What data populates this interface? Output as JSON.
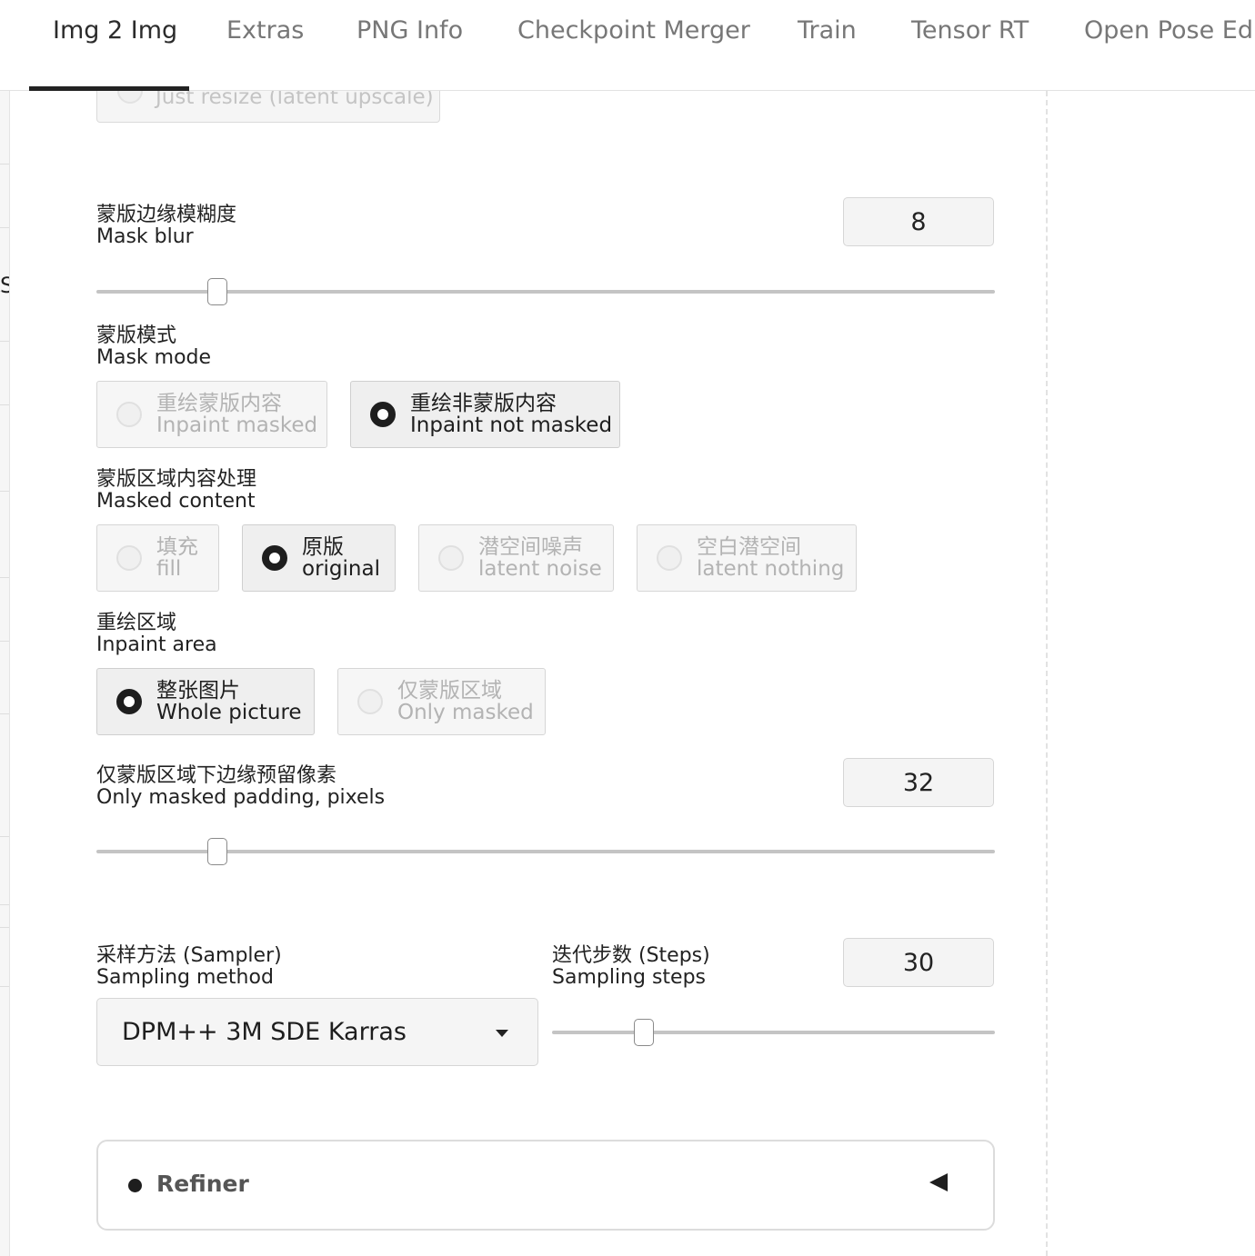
{
  "tabs": [
    {
      "label": "Img 2 Img",
      "active": true
    },
    {
      "label": "Extras"
    },
    {
      "label": "PNG Info"
    },
    {
      "label": "Checkpoint Merger"
    },
    {
      "label": "Train"
    },
    {
      "label": "Tensor RT"
    },
    {
      "label": "Open Pose Edit"
    }
  ],
  "left_strip": {
    "partial_char": "S("
  },
  "resize_mode": {
    "visible_option": "Just resize (latent upscale)"
  },
  "mask_blur": {
    "label_zh": "蒙版边缘模糊度",
    "label_en": "Mask blur",
    "value": "8",
    "slider_fraction": 0.125
  },
  "mask_mode": {
    "label_zh": "蒙版模式",
    "label_en": "Mask mode",
    "options": [
      {
        "zh": "重绘蒙版内容",
        "en": "Inpaint masked",
        "selected": false
      },
      {
        "zh": "重绘非蒙版内容",
        "en": "Inpaint not masked",
        "selected": true
      }
    ]
  },
  "masked_content": {
    "label_zh": "蒙版区域内容处理",
    "label_en": "Masked content",
    "options": [
      {
        "zh": "填充",
        "en": "fill",
        "selected": false
      },
      {
        "zh": "原版",
        "en": "original",
        "selected": true
      },
      {
        "zh": "潜空间噪声",
        "en": "latent noise",
        "selected": false
      },
      {
        "zh": "空白潜空间",
        "en": "latent nothing",
        "selected": false
      }
    ]
  },
  "inpaint_area": {
    "label_zh": "重绘区域",
    "label_en": "Inpaint area",
    "options": [
      {
        "zh": "整张图片",
        "en": "Whole picture",
        "selected": true
      },
      {
        "zh": "仅蒙版区域",
        "en": "Only masked",
        "selected": false
      }
    ]
  },
  "padding": {
    "label_zh": "仅蒙版区域下边缘预留像素",
    "label_en": "Only masked padding, pixels",
    "value": "32",
    "slider_fraction": 0.125
  },
  "sampler": {
    "label_zh": "采样方法 (Sampler)",
    "label_en": "Sampling method",
    "value": "DPM++ 3M SDE Karras"
  },
  "steps": {
    "label_zh": "迭代步数 (Steps)",
    "label_en": "Sampling steps",
    "value": "30",
    "slider_fraction": 0.2
  },
  "refiner": {
    "label": "Refiner"
  },
  "colors": {
    "accent": "#1e1e1e",
    "tab_inactive": "#777777",
    "disabled_text": "#b3b3b3"
  }
}
